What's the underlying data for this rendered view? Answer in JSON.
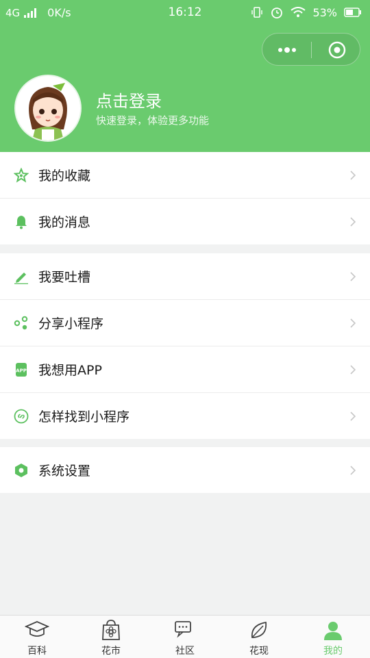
{
  "status_bar": {
    "network": "4G",
    "speed": "0K/s",
    "time": "16:12",
    "battery": "53%"
  },
  "profile": {
    "title": "点击登录",
    "subtitle": "快速登录，体验更多功能"
  },
  "menu": {
    "group1": [
      {
        "label": "我的收藏",
        "icon": "star-icon"
      },
      {
        "label": "我的消息",
        "icon": "bell-icon"
      }
    ],
    "group2": [
      {
        "label": "我要吐槽",
        "icon": "pencil-icon"
      },
      {
        "label": "分享小程序",
        "icon": "share-icon"
      },
      {
        "label": "我想用APP",
        "icon": "app-icon"
      },
      {
        "label": "怎样找到小程序",
        "icon": "link-icon"
      }
    ],
    "group3": [
      {
        "label": "系统设置",
        "icon": "settings-icon"
      }
    ]
  },
  "tabbar": [
    {
      "label": "百科",
      "icon": "graduation-cap-icon",
      "active": false
    },
    {
      "label": "花市",
      "icon": "flower-bag-icon",
      "active": false
    },
    {
      "label": "社区",
      "icon": "chat-bubbles-icon",
      "active": false
    },
    {
      "label": "花现",
      "icon": "leaf-icon",
      "active": false
    },
    {
      "label": "我的",
      "icon": "user-icon",
      "active": true
    }
  ],
  "colors": {
    "brand_green": "#6acb6e",
    "background": "#f1f2f2"
  }
}
